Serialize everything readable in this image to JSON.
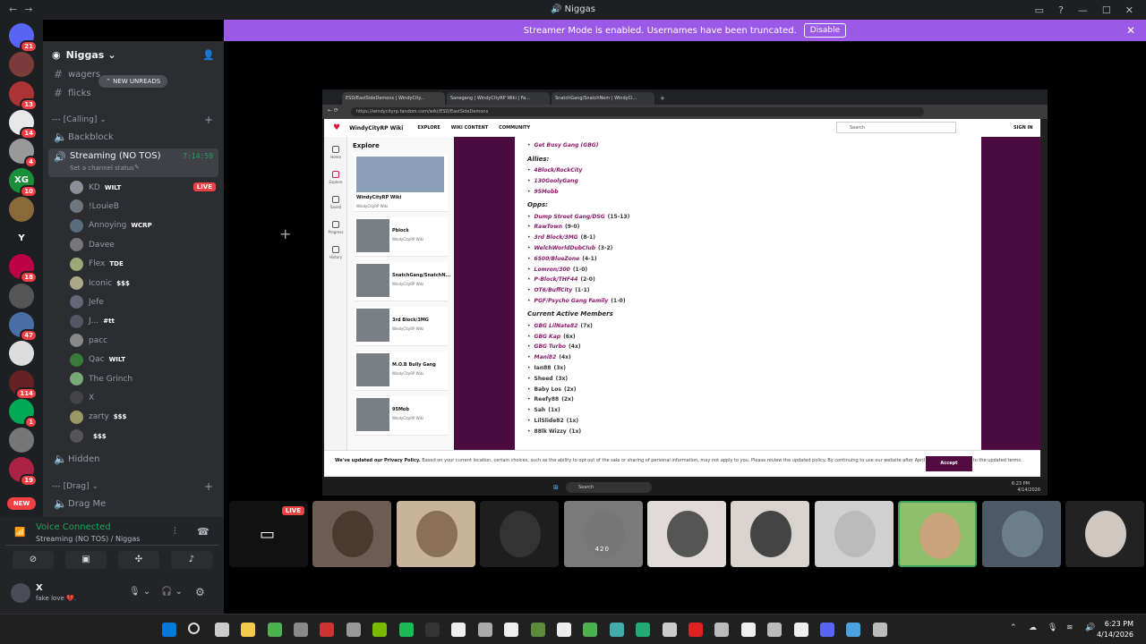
{
  "window": {
    "title": "Niggas"
  },
  "streamer_banner": {
    "text": "Streamer Mode is enabled. Usernames have been truncated.",
    "disable_label": "Disable"
  },
  "servers": [
    {
      "badge": "21"
    },
    {
      "badge": ""
    },
    {
      "badge": "13"
    },
    {
      "badge": "14"
    },
    {
      "badge": "4"
    },
    {
      "label": "XG",
      "badge": "10"
    },
    {
      "badge": ""
    },
    {
      "label": "Y",
      "badge": ""
    },
    {
      "badge": "18"
    },
    {
      "badge": ""
    },
    {
      "badge": "47"
    },
    {
      "badge": ""
    },
    {
      "badge": "114"
    },
    {
      "badge": "1"
    },
    {
      "badge": ""
    },
    {
      "badge": "19"
    }
  ],
  "new_label": "NEW",
  "guild": {
    "name": "Niggas"
  },
  "new_unreads": "NEW UNREADS",
  "channels_top": [
    {
      "name": "wagers"
    },
    {
      "name": "flicks"
    }
  ],
  "category_calling": "--- [Calling]",
  "backblock": "Backblock",
  "voice_channel": {
    "name": "Streaming (NO TOS)",
    "timer": "7:14:59",
    "status": "Set a channel status"
  },
  "voice_users": [
    {
      "name": "KD",
      "tag": "WILT",
      "live": "LIVE"
    },
    {
      "name": "!LouieB",
      "tag": "",
      "live": ""
    },
    {
      "name": "Annoying",
      "tag": "WCRP",
      "live": ""
    },
    {
      "name": "Davee",
      "tag": "",
      "live": ""
    },
    {
      "name": "Flex",
      "tag": "TDE",
      "live": ""
    },
    {
      "name": "Iconic",
      "tag": "$$$",
      "live": ""
    },
    {
      "name": "Jefe",
      "tag": "",
      "live": ""
    },
    {
      "name": "J...",
      "tag": "#tt",
      "live": ""
    },
    {
      "name": "pacc",
      "tag": "",
      "live": ""
    },
    {
      "name": "Qac",
      "tag": "WILT",
      "live": ""
    },
    {
      "name": "The Grinch",
      "tag": "",
      "live": ""
    },
    {
      "name": "X",
      "tag": "",
      "live": ""
    },
    {
      "name": "zarty",
      "tag": "$$$",
      "live": ""
    },
    {
      "name": "",
      "tag": "$$$",
      "live": ""
    }
  ],
  "hidden": "Hidden",
  "category_drag": "--- [Drag]",
  "drag_me": "Drag Me",
  "voice_connected": {
    "title": "Voice Connected",
    "subtitle": "Streaming (NO TOS) / Niggas"
  },
  "user": {
    "name": "X",
    "status": "fake love 💔."
  },
  "browser": {
    "tabs": [
      "ESD/EastSideDemons | WindyCity...",
      "Sanegang | WindyCityRP Wiki | Fa...",
      "SnatchGang/SnatchNem | WindyCi..."
    ],
    "url": "https://windycityrp.fandom.com/wiki/ESD/EastSideDemons",
    "wiki_name": "WindyCityRP Wiki",
    "nav": [
      "EXPLORE",
      "WIKI CONTENT",
      "COMMUNITY"
    ],
    "search_placeholder": "Search",
    "sign_in": "SIGN IN",
    "rail": [
      "Home",
      "Explore",
      "Saved",
      "Progress",
      "History"
    ],
    "explore_title": "Explore",
    "explore_items": [
      {
        "title": "WindyCityRP Wiki",
        "sub": "WindyCityRP Wiki"
      },
      {
        "title": "Pblock",
        "sub": "WindyCityRP Wiki"
      },
      {
        "title": "SnatchGang/SnatchN...",
        "sub": "WindyCityRP Wiki"
      },
      {
        "title": "3rd Block/3MG",
        "sub": "WindyCityRP Wiki"
      },
      {
        "title": "M.O.B Bully Gang",
        "sub": "WindyCityRP Wiki"
      },
      {
        "title": "95Mob",
        "sub": "WindyCityRP Wiki"
      }
    ],
    "top_item": "Get Busy Gang (GBG)",
    "allies_title": "Allies:",
    "allies": [
      "4Block/RockCity",
      "130GoolyGang",
      "95Mobb"
    ],
    "opps_title": "Opps:",
    "opps": [
      {
        "name": "Dump Street Gang/DSG",
        "score": "(15-13)"
      },
      {
        "name": "RawTown",
        "score": "(9-0)"
      },
      {
        "name": "3rd Block/3MG",
        "score": "(8-1)"
      },
      {
        "name": "WelchWorldDubClub",
        "score": "(3-2)"
      },
      {
        "name": "6500/BlueZone",
        "score": "(4-1)"
      },
      {
        "name": "Lomron/300",
        "score": "(1-0)"
      },
      {
        "name": "P-Block/THF44",
        "score": "(2-0)"
      },
      {
        "name": "OT6/BuffCity",
        "score": "(1-1)"
      },
      {
        "name": "PGF/Psycho Gang Family",
        "score": "(1-0)"
      }
    ],
    "members_title": "Current Active Members",
    "members": [
      {
        "name": "GBG LilNate82",
        "count": "(7x)",
        "link": true
      },
      {
        "name": "GBG Kap",
        "count": "(6x)",
        "link": true
      },
      {
        "name": "GBG Turbo",
        "count": "(4x)",
        "link": true
      },
      {
        "name": "Mani82",
        "count": "(4x)",
        "link": true
      },
      {
        "name": "Ian88",
        "count": "(3x)",
        "link": false
      },
      {
        "name": "Sheed",
        "count": "(3x)",
        "link": false
      },
      {
        "name": "Baby Los",
        "count": "(2x)",
        "link": false
      },
      {
        "name": "Reefy88",
        "count": "(2x)",
        "link": false
      },
      {
        "name": "Sah",
        "count": "(1x)",
        "link": false
      },
      {
        "name": "LilSlide82",
        "count": "(1x)",
        "link": false
      },
      {
        "name": "88lk Wizzy",
        "count": "(1x)",
        "link": false
      }
    ],
    "cookie_bold": "We've updated our Privacy Policy.",
    "cookie_text": "Based on your current location, certain choices, such as the ability to opt out of the sale or sharing of personal information, may not apply to you. Please review the updated policy. By continuing to use our website after April 28, 2026, you agree to the updated terms.",
    "accept": "Accept",
    "inner_search": "Search",
    "inner_time": "6:23 PM",
    "inner_date": "4/14/2026"
  },
  "thumb_live": "LIVE",
  "tile_text": "420",
  "clock": {
    "time": "6:23 PM",
    "date": "4/14/2026"
  },
  "colors": {
    "blurple": "#9b59e8",
    "live_red": "#ed4245",
    "green": "#23a55a"
  }
}
